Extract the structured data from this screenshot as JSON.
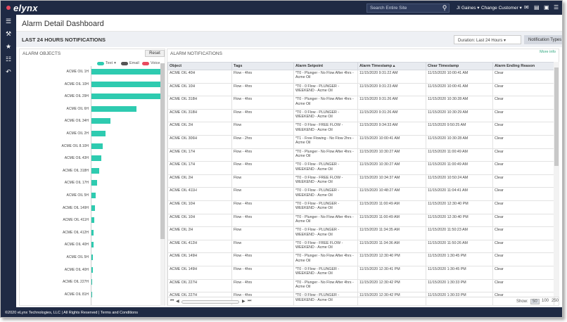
{
  "header": {
    "logo": "elynx",
    "search_placeholder": "Search Entire Site",
    "user": "JI Gaines",
    "change_customer": "Change Customer"
  },
  "page": {
    "title": "Alarm Detail Dashboard",
    "subtitle": "LAST 24 HOURS NOTIFICATIONS",
    "duration": "Duration: Last 24 Hours",
    "notification_types": "Notification Types"
  },
  "left_panel": {
    "title": "ALARM OBJECTS",
    "reset": "Reset",
    "legend": [
      {
        "label": "Text",
        "color": "#2ecbb0"
      },
      {
        "label": "Email",
        "color": "#555555"
      },
      {
        "label": "Voice",
        "color": "#e84a5f"
      }
    ]
  },
  "chart_data": {
    "type": "bar",
    "orientation": "horizontal",
    "categories": [
      "ACME OIL 1H",
      "ACME OIL 10H",
      "ACME OIL 29H",
      "ACME OIL 6H",
      "ACME OIL 34H",
      "ACME OIL 2H",
      "ACME OIL 8.10H",
      "ACME OIL 43H",
      "ACME OIL 318H",
      "ACME OIL 17H",
      "ACME OIL 5H",
      "ACME OIL 149H",
      "ACME OIL 411H",
      "ACME OIL 412H",
      "ACME OIL 40H",
      "ACME OIL 5H",
      "ACME OIL 40H",
      "ACME OIL 227H",
      "ACME OIL 81H"
    ],
    "values": [
      100,
      100,
      100,
      65,
      28,
      20,
      16,
      14,
      11,
      8,
      6,
      5,
      4,
      3,
      3,
      2,
      2,
      1,
      1
    ],
    "series": [
      {
        "name": "Text",
        "color": "#2ecbb0"
      }
    ]
  },
  "right_panel": {
    "title": "ALARM NOTIFICATIONS",
    "more_info": "More info",
    "columns": [
      "Object",
      "Tags",
      "Alarm Setpoint",
      "Alarm Timestamp ▴",
      "Clear Timestamp",
      "Alarm Ending Reason"
    ],
    "rows": [
      [
        "ACME OIL 40H",
        "Flow - 4hrs",
        "*T0 - Plunger - No Flow After 4hrs - Acme Oil",
        "11/15/2020 9:31:22 AM",
        "11/15/2020 10:00:41 AM",
        "Clear"
      ],
      [
        "ACME OIL 10H",
        "Flow - 4hrs",
        "*T0 - 0 Flow - PLUNGER - WEEKEND - Acme Oil",
        "11/15/2020 9:31:23 AM",
        "11/15/2020 10:00:41 AM",
        "Clear"
      ],
      [
        "ACME OIL 318H",
        "Flow - 4hrs",
        "*T0 - Plunger - No Flow After 4hrs - Acme Oil",
        "11/15/2020 9:31:26 AM",
        "11/15/2020 10:30:28 AM",
        "Clear"
      ],
      [
        "ACME OIL 318H",
        "Flow - 4hrs",
        "*T0 - 0 Flow - PLUNGER - WEEKEND - Acme Oil",
        "11/15/2020 9:31:26 AM",
        "11/15/2020 10:30:29 AM",
        "Clear"
      ],
      [
        "ACME OIL 2H",
        "Flow",
        "*T0 - 0 Flow - FREE FLOW - WEEKEND - Acme Oil",
        "11/15/2020 9:34:33 AM",
        "11/15/2020 9:50:25 AM",
        "Clear"
      ],
      [
        "ACME OIL 306H",
        "Flow - 2hrs",
        "*T1 - Free Flowing - No Flow 2hrs - Acme Oil",
        "11/15/2020 10:00:41 AM",
        "11/15/2020 10:30:28 AM",
        "Clear"
      ],
      [
        "ACME OIL 17H",
        "Flow - 4hrs",
        "*T0 - Plunger - No Flow After 4hrs - Acme Oil",
        "11/15/2020 10:30:27 AM",
        "11/15/2020 11:00:49 AM",
        "Clear"
      ],
      [
        "ACME OIL 17H",
        "Flow - 4hrs",
        "*T0 - 0 Flow - PLUNGER - WEEKEND - Acme Oil",
        "11/15/2020 10:30:27 AM",
        "11/15/2020 11:00:49 AM",
        "Clear"
      ],
      [
        "ACME OIL 2H",
        "Flow",
        "*T0 - 0 Flow - FREE FLOW - WEEKEND - Acme Oil",
        "11/15/2020 10:34:37 AM",
        "11/15/2020 10:50:24 AM",
        "Clear"
      ],
      [
        "ACME OIL 411H",
        "Flow",
        "*T0 - 0 Flow - PLUNGER - WEEKEND - Acme Oil",
        "11/15/2020 10:48:27 AM",
        "11/15/2020 11:04:41 AM",
        "Clear"
      ],
      [
        "ACME OIL 10H",
        "Flow - 4hrs",
        "*T0 - 0 Flow - PLUNGER - WEEKEND - Acme Oil",
        "11/15/2020 11:00:49 AM",
        "11/15/2020 12:30:40 PM",
        "Clear"
      ],
      [
        "ACME OIL 10H",
        "Flow - 4hrs",
        "*T0 - Plunger - No Flow After 4hrs - Acme Oil",
        "11/15/2020 11:00:49 AM",
        "11/15/2020 12:30:40 PM",
        "Clear"
      ],
      [
        "ACME OIL 2H",
        "Flow",
        "*T0 - 0 Flow - PLUNGER - WEEKEND - Acme Oil",
        "11/15/2020 11:34:35 AM",
        "11/15/2020 11:50:23 AM",
        "Clear"
      ],
      [
        "ACME OIL 412H",
        "Flow",
        "*T0 - 0 Flow - FREE FLOW - WEEKEND - Acme Oil",
        "11/15/2020 11:34:36 AM",
        "11/15/2020 11:50:26 AM",
        "Clear"
      ],
      [
        "ACME OIL 149H",
        "Flow - 4hrs",
        "*T0 - Plunger - No Flow After 4hrs - Acme Oil",
        "11/15/2020 12:30:40 PM",
        "11/15/2020 1:30:45 PM",
        "Clear"
      ],
      [
        "ACME OIL 149H",
        "Flow - 4hrs",
        "*T0 - 0 Flow - PLUNGER - WEEKEND - Acme Oil",
        "11/15/2020 12:30:41 PM",
        "11/15/2020 1:30:45 PM",
        "Clear"
      ],
      [
        "ACME OIL 227H",
        "Flow - 4hrs",
        "*T0 - Plunger - No Flow After 4hrs - Acme Oil",
        "11/15/2020 12:30:42 PM",
        "11/15/2020 1:30:33 PM",
        "Clear"
      ],
      [
        "ACME OIL 227H",
        "Flow - 4hrs",
        "*T0 - 0 Flow - PLUNGER - WEEKEND - Acme Oil",
        "11/15/2020 12:30:42 PM",
        "11/15/2020 1:30:33 PM",
        "Clear"
      ]
    ]
  },
  "pager": {
    "show_label": "Show:",
    "sizes": [
      "50",
      "100",
      "250"
    ],
    "selected": "50"
  },
  "footer": {
    "text": "©2020 eLynx Technologies, LLC | All Rights Reserved | Terms and Conditions"
  }
}
